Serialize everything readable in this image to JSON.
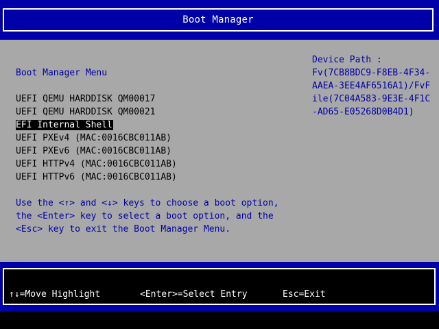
{
  "header": {
    "title": "Boot Manager"
  },
  "menu": {
    "title": "Boot Manager Menu",
    "items": [
      {
        "label": "UEFI QEMU HARDDISK QM00017",
        "selected": false
      },
      {
        "label": "UEFI QEMU HARDDISK QM00021",
        "selected": false
      },
      {
        "label": "EFI Internal Shell",
        "selected": true
      },
      {
        "label": "UEFI PXEv4 (MAC:0016CBC011AB)",
        "selected": false
      },
      {
        "label": "UEFI PXEv6 (MAC:0016CBC011AB)",
        "selected": false
      },
      {
        "label": "UEFI HTTPv4 (MAC:0016CBC011AB)",
        "selected": false
      },
      {
        "label": "UEFI HTTPv6 (MAC:0016CBC011AB)",
        "selected": false
      }
    ]
  },
  "help": {
    "lines": [
      "Use the <↑> and <↓> keys to choose a boot option,",
      "the <Enter> key to select a boot option, and the",
      "<Esc> key to exit the Boot Manager Menu."
    ]
  },
  "device_path": {
    "label": "Device Path :",
    "lines": [
      "Fv(7CB8BDC9-F8EB-4F34-",
      "AAEA-3EE4AF6516A1)/FvF",
      "ile(7C04A583-9E3E-4F1C",
      "-AD65-E05268D0B4D1)"
    ]
  },
  "footer": {
    "move_hint": "↑↓=Move Highlight",
    "select_hint": "<Enter>=Select Entry",
    "exit_hint": "Esc=Exit"
  },
  "colors": {
    "blue": "#0000a8",
    "gray": "#a8a8a8",
    "white": "#ffffff",
    "black": "#000000"
  }
}
